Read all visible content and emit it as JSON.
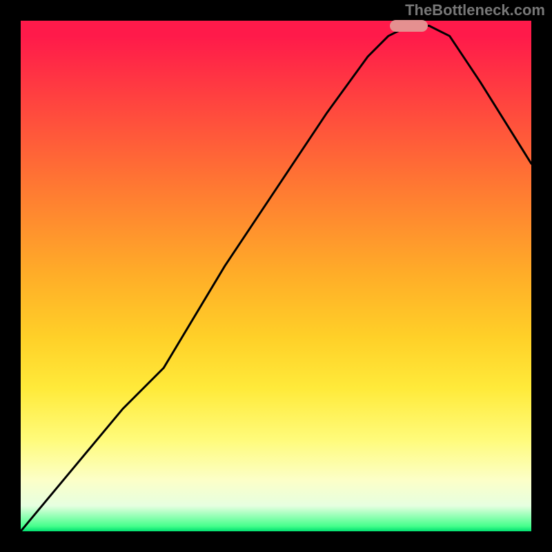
{
  "watermark": "TheBottleneck.com",
  "colors": {
    "marker": "#e59090",
    "curve_stroke": "#000000",
    "gradient_top": "#ff1a4a",
    "gradient_bottom": "#00e070"
  },
  "chart_data": {
    "type": "line",
    "title": "",
    "xlabel": "",
    "ylabel": "",
    "xlim": [
      0,
      100
    ],
    "ylim": [
      0,
      100
    ],
    "grid": false,
    "legend": false,
    "marker": {
      "x": 76,
      "y": 99,
      "width_pct": 7.5,
      "height_pct": 2.2
    },
    "series": [
      {
        "name": "bottleneck-curve",
        "x": [
          0,
          10,
          20,
          28,
          40,
          50,
          60,
          68,
          72,
          76,
          80,
          84,
          90,
          100
        ],
        "y": [
          0,
          12,
          24,
          32,
          52,
          67,
          82,
          93,
          97,
          99,
          99,
          97,
          88,
          72
        ]
      }
    ]
  }
}
